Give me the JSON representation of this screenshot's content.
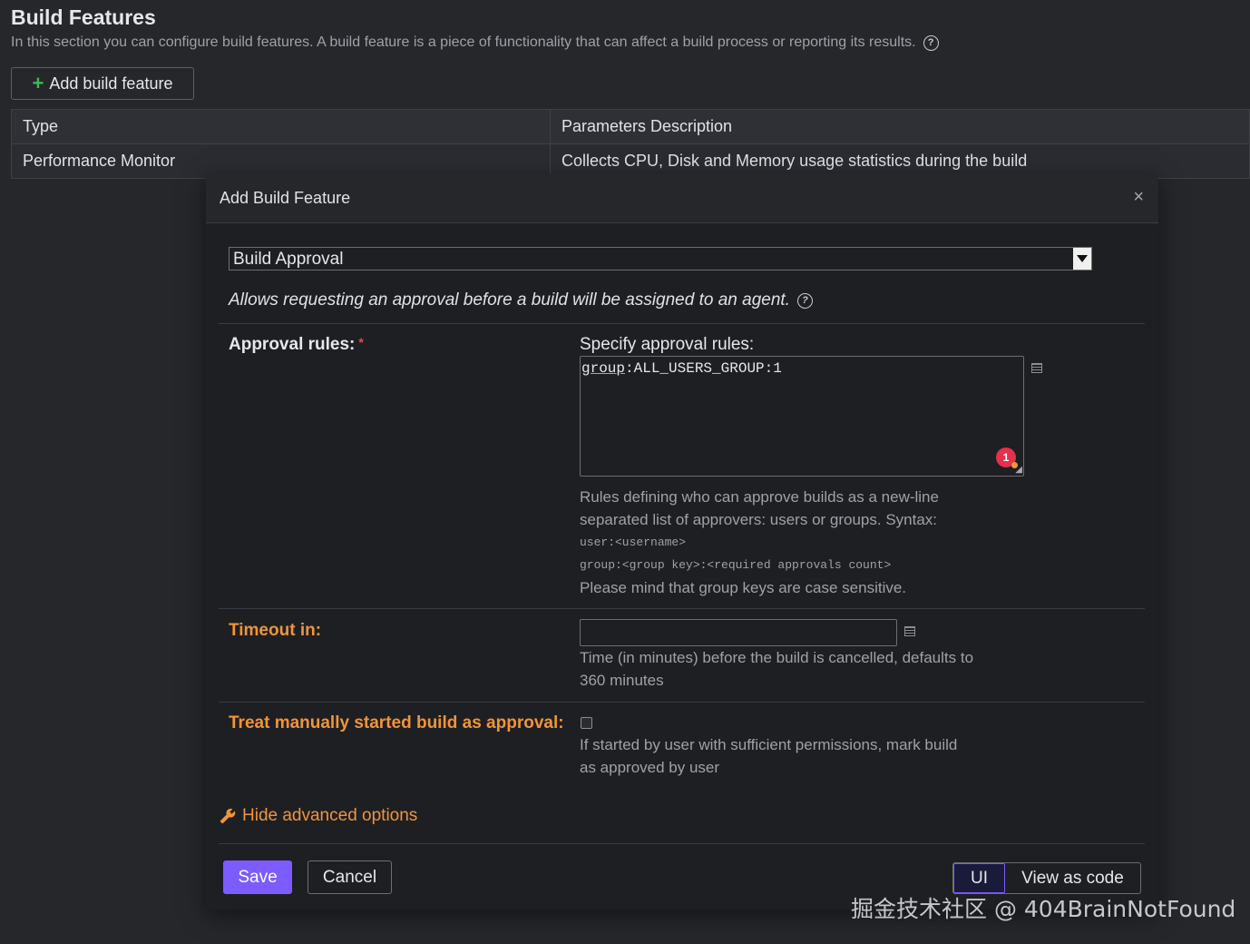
{
  "header": {
    "title": "Build Features",
    "subtitle": "In this section you can configure build features. A build feature is a piece of functionality that can affect a build process or reporting its results.",
    "help_glyph": "?",
    "add_button": "Add build feature"
  },
  "table": {
    "columns": [
      "Type",
      "Parameters Description"
    ],
    "rows": [
      [
        "Performance Monitor",
        "Collects CPU, Disk and Memory usage statistics during the build"
      ]
    ]
  },
  "dialog": {
    "title": "Add Build Feature",
    "close": "×",
    "feature_select": "Build Approval",
    "feature_description": "Allows requesting an approval before a build will be assigned to an agent.",
    "approval_rules": {
      "label": "Approval rules:",
      "required_mark": "*",
      "specify_label": "Specify approval rules:",
      "value_keyword": "group",
      "value_rest": ":ALL_USERS_GROUP:1",
      "error_count": "1",
      "help_line1": "Rules defining who can approve builds as a new-line separated list of approvers: users or groups. Syntax:",
      "syntax_user": "user:<username>",
      "syntax_group": "group:<group key>:<required approvals count>",
      "help_line2": "Please mind that group keys are case sensitive."
    },
    "timeout": {
      "label": "Timeout in:",
      "value": "",
      "help": "Time (in minutes) before the build is cancelled, defaults to 360 minutes"
    },
    "manual_approval": {
      "label": "Treat manually started build as approval:",
      "checked": false,
      "help": "If started by user with sufficient permissions, mark build as approved by user"
    },
    "advanced_link": "Hide advanced options",
    "save": "Save",
    "cancel": "Cancel",
    "mode_ui": "UI",
    "mode_code": "View as code"
  },
  "watermark": "掘金技术社区 @ 404BrainNotFound",
  "colors": {
    "accent": "#7c5cff",
    "warning": "#f0943a",
    "error": "#e5304d",
    "success": "#3fb950"
  }
}
